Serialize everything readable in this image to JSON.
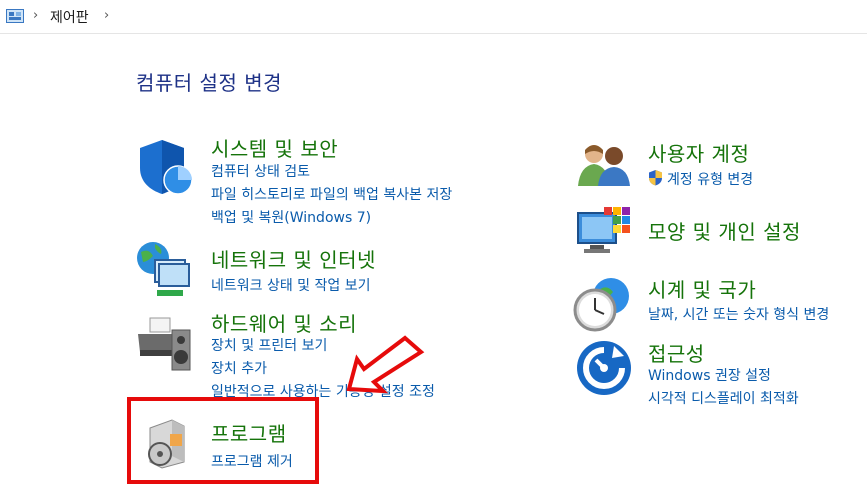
{
  "breadcrumb": {
    "item": "제어판"
  },
  "page_title": "컴퓨터 설정 변경",
  "left": [
    {
      "title": "시스템 및 보안",
      "icon": "shield-icon",
      "links": [
        "컴퓨터 상태 검토",
        "파일 히스토리로 파일의 백업 복사본 저장",
        "백업 및 복원(Windows 7)"
      ]
    },
    {
      "title": "네트워크 및 인터넷",
      "icon": "network-globe-icon",
      "links": [
        "네트워크 상태 및 작업 보기"
      ]
    },
    {
      "title": "하드웨어 및 소리",
      "icon": "printer-speaker-icon",
      "links": [
        "장치 및 프린터 보기",
        "장치 추가",
        "일반적으로 사용하는 기동성 설정 조정"
      ]
    },
    {
      "title": "프로그램",
      "icon": "programs-disc-icon",
      "links": [
        "프로그램 제거"
      ]
    }
  ],
  "right": [
    {
      "title": "사용자 계정",
      "icon": "users-icon",
      "links": [
        "계정 유형 변경"
      ]
    },
    {
      "title": "모양 및 개인 설정",
      "icon": "monitor-palette-icon",
      "links": []
    },
    {
      "title": "시계 및 국가",
      "icon": "clock-globe-icon",
      "links": [
        "날짜, 시간 또는 숫자 형식 변경"
      ]
    },
    {
      "title": "접근성",
      "icon": "accessibility-icon",
      "links": [
        "Windows 권장 설정",
        "시각적 디스플레이 최적화"
      ]
    }
  ],
  "colors": {
    "category_title": "#15730a",
    "link": "#0a5bab",
    "page_title": "#1e3287",
    "highlight": "#e60b0b"
  }
}
